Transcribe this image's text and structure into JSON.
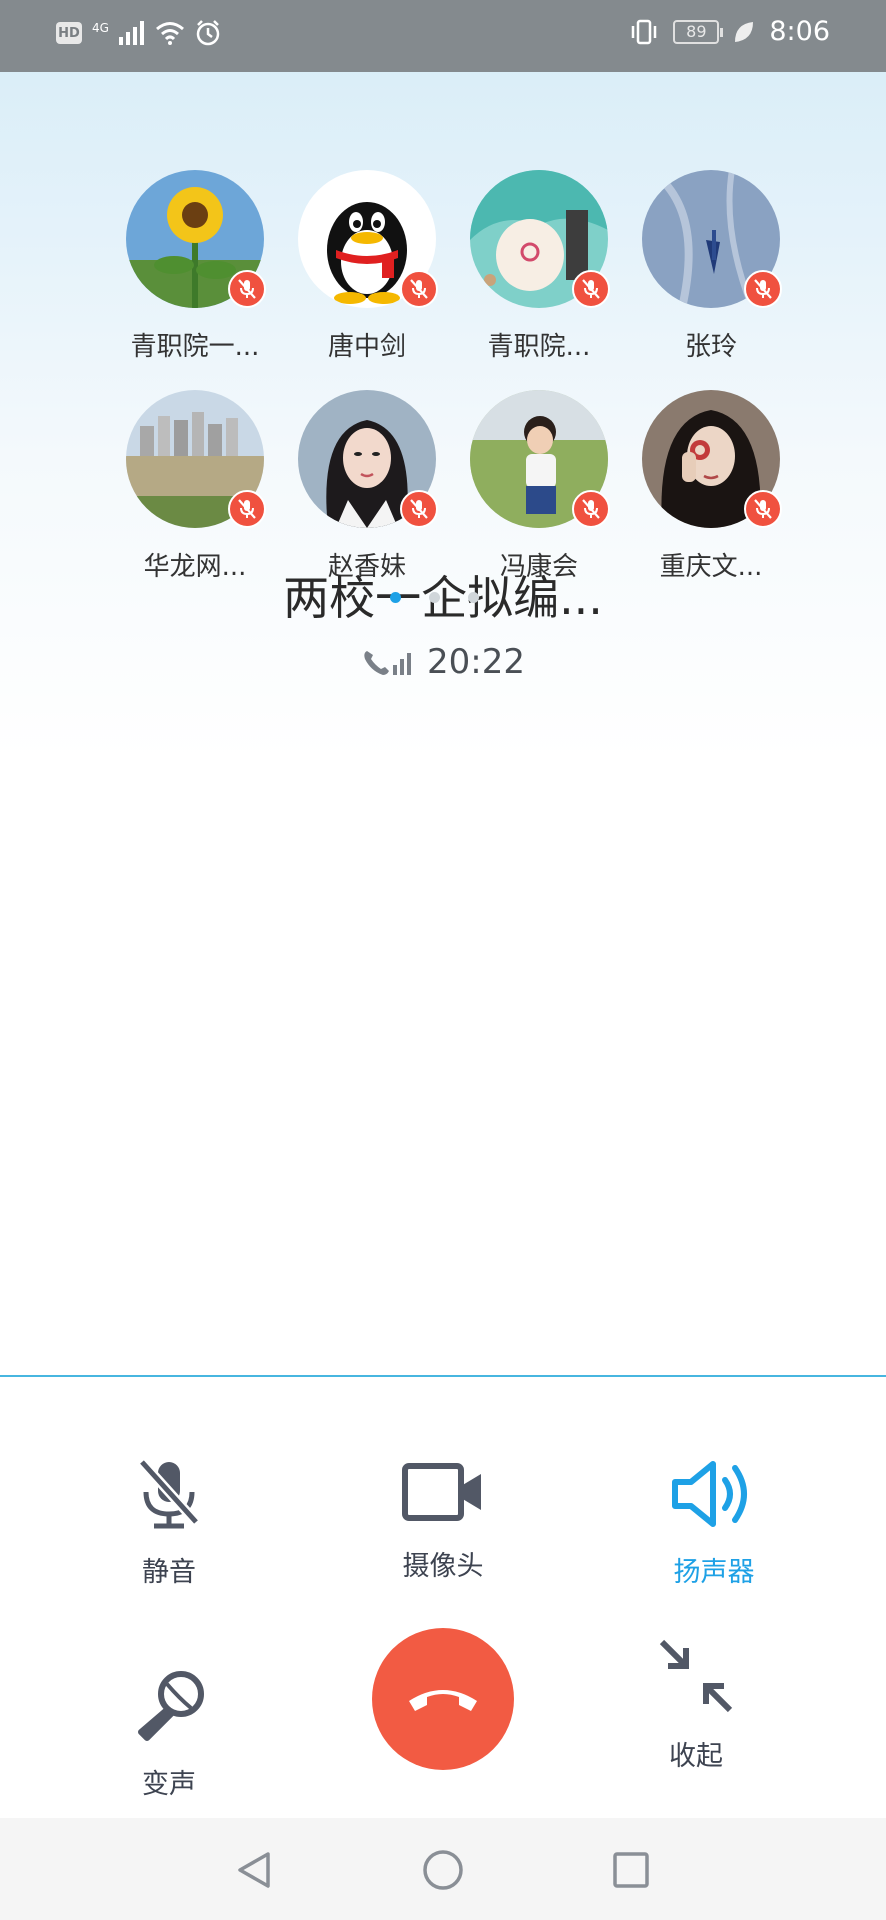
{
  "status_bar": {
    "hd": "HD",
    "network": "4G",
    "battery": "89",
    "time": "8:06"
  },
  "participants": [
    {
      "name": "青职院一...",
      "avatar": "sunflower-photo"
    },
    {
      "name": "唐中剑",
      "avatar": "qq-penguin"
    },
    {
      "name": "青职院...",
      "avatar": "cartoon-girl"
    },
    {
      "name": "张玲",
      "avatar": "blue-abstract"
    },
    {
      "name": "华龙网...",
      "avatar": "city-river-photo"
    },
    {
      "name": "赵香妹",
      "avatar": "girl-portrait"
    },
    {
      "name": "冯康会",
      "avatar": "child-photo"
    },
    {
      "name": "重庆文...",
      "avatar": "woman-portrait"
    }
  ],
  "call": {
    "title": "两校一企拟编...",
    "duration": "20:22"
  },
  "controls": {
    "mute": "静音",
    "camera": "摄像头",
    "speaker": "扬声器",
    "voice_change": "变声",
    "collapse": "收起"
  },
  "colors": {
    "accent": "#1ea1e6",
    "hangup": "#f25b43",
    "mute_badge": "#f0513f"
  }
}
